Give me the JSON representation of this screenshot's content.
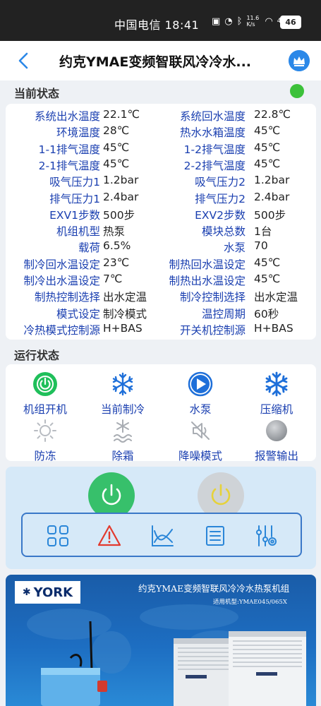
{
  "statusbar": {
    "carrier_time": "中国电信 18:41",
    "net_speed": "11.6 K/s",
    "signal": "4G",
    "battery": "46"
  },
  "header": {
    "title": "约克YMAE变频智联风冷冷水..."
  },
  "status_section": {
    "title": "当前状态",
    "indicator_color": "#3cc13a",
    "rows": [
      {
        "l_label": "系统出水温度",
        "l_value": "22.1℃",
        "r_label": "系统回水温度",
        "r_value": "22.8℃"
      },
      {
        "l_label": "环境温度",
        "l_value": "28℃",
        "r_label": "热水水箱温度",
        "r_value": "45℃"
      },
      {
        "l_label": "1-1排气温度",
        "l_value": "45℃",
        "r_label": "1-2排气温度",
        "r_value": "45℃"
      },
      {
        "l_label": "2-1排气温度",
        "l_value": "45℃",
        "r_label": "2-2排气温度",
        "r_value": "45℃"
      },
      {
        "l_label": "吸气压力1",
        "l_value": "1.2bar",
        "r_label": "吸气压力2",
        "r_value": "1.2bar"
      },
      {
        "l_label": "排气压力1",
        "l_value": "2.4bar",
        "r_label": "排气压力2",
        "r_value": "2.4bar"
      },
      {
        "l_label": "EXV1步数",
        "l_value": "500步",
        "r_label": "EXV2步数",
        "r_value": "500步"
      },
      {
        "l_label": "机组机型",
        "l_value": "热泵",
        "r_label": "模块总数",
        "r_value": "1台"
      },
      {
        "l_label": "载荷",
        "l_value": "6.5%",
        "r_label": "水泵",
        "r_value": "70"
      },
      {
        "l_label": "制冷回水温设定",
        "l_value": "23℃",
        "r_label": "制热回水温设定",
        "r_value": "45℃"
      },
      {
        "l_label": "制冷出水温设定",
        "l_value": "7℃",
        "r_label": "制热出水温设定",
        "r_value": "45℃"
      },
      {
        "l_label": "制热控制选择",
        "l_value": "出水定温",
        "r_label": "制冷控制选择",
        "r_value": "出水定温"
      },
      {
        "l_label": "模式设定",
        "l_value": "制冷模式",
        "r_label": "温控周期",
        "r_value": "60秒"
      },
      {
        "l_label": "冷热模式控制源",
        "l_value": "H+BAS",
        "r_label": "开关机控制源",
        "r_value": "H+BAS"
      }
    ]
  },
  "run_section": {
    "title": "运行状态",
    "items": [
      {
        "label": "机组开机",
        "icon": "power-icon",
        "active": true
      },
      {
        "label": "当前制冷",
        "icon": "snowflake-icon",
        "active": true
      },
      {
        "label": "水泵",
        "icon": "pump-icon",
        "active": true
      },
      {
        "label": "压缩机",
        "icon": "snowflake-icon",
        "active": true
      },
      {
        "label": "防冻",
        "icon": "sun-icon",
        "active": false
      },
      {
        "label": "除霜",
        "icon": "defrost-icon",
        "active": false
      },
      {
        "label": "降噪模式",
        "icon": "mute-icon",
        "active": false
      },
      {
        "label": "报警输出",
        "icon": "alarm-dot-icon",
        "active": false
      }
    ]
  },
  "controls": {
    "power_on_color": "#37c06b",
    "power_off_color": "#cfd3d7",
    "tools": [
      "grid-icon",
      "warning-icon",
      "chart-icon",
      "list-icon",
      "settings-sliders-icon"
    ]
  },
  "banner": {
    "brand": "YORK",
    "title": "约克YMAE变频智联风冷冷水热泵机组",
    "subtitle": "适用机型:YMAE045/065X"
  }
}
